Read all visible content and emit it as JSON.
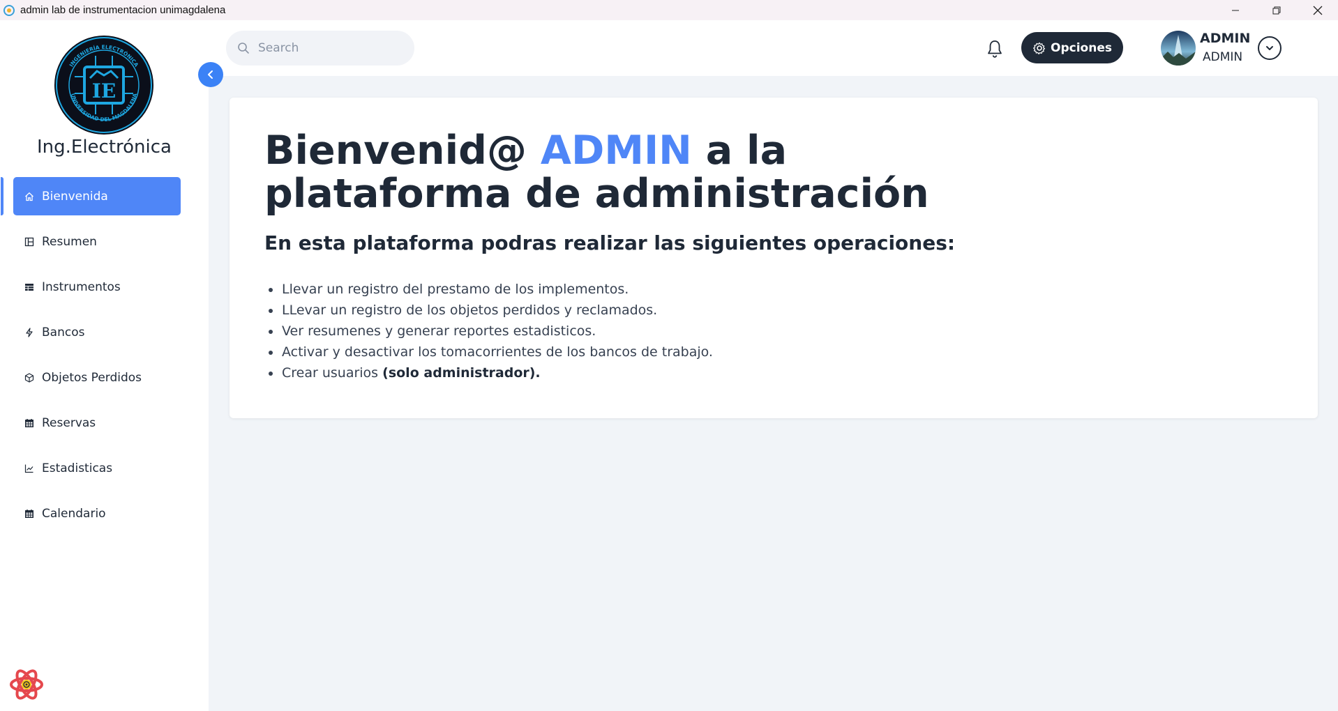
{
  "window": {
    "title": "admin lab de instrumentacion unimagdalena"
  },
  "sidebar": {
    "brand": "Ing.Electrónica",
    "logo_text": {
      "initials": "IE",
      "ring_top": "INGENIERÍA ELECTRÓNICA",
      "ring_bottom": "UNIVERSIDAD DEL MAGDALENA"
    },
    "items": [
      {
        "label": "Bienvenida",
        "icon": "home-icon",
        "active": true
      },
      {
        "label": "Resumen",
        "icon": "dashboard-icon"
      },
      {
        "label": "Instrumentos",
        "icon": "table-icon"
      },
      {
        "label": "Bancos",
        "icon": "bolt-icon"
      },
      {
        "label": "Objetos Perdidos",
        "icon": "box-icon"
      },
      {
        "label": "Reservas",
        "icon": "calendar-icon"
      },
      {
        "label": "Estadisticas",
        "icon": "chart-line-icon"
      },
      {
        "label": "Calendario",
        "icon": "calendar-icon"
      }
    ]
  },
  "header": {
    "search_placeholder": "Search",
    "options_label": "Opciones",
    "user": {
      "name": "ADMIN",
      "role": "ADMIN"
    }
  },
  "main": {
    "welcome_prefix": "Bienvenid@",
    "welcome_name": "ADMIN",
    "welcome_suffix_line1": "a la",
    "welcome_line2": "plataforma de administración",
    "subtitle": "En esta plataforma podras realizar las siguientes operaciones:",
    "operations": [
      "Llevar un registro del prestamo de los implementos.",
      "LLevar un registro de los objetos perdidos y reclamados.",
      "Ver resumenes y generar reportes estadisticos.",
      "Activar y desactivar los tomacorrientes de los bancos de trabajo."
    ],
    "last_operation_prefix": "Crear usuarios",
    "last_operation_bold": "(solo administrador)."
  },
  "colors": {
    "accent": "#4f86f7",
    "dark": "#1f2937",
    "background": "#f1f4f8"
  }
}
